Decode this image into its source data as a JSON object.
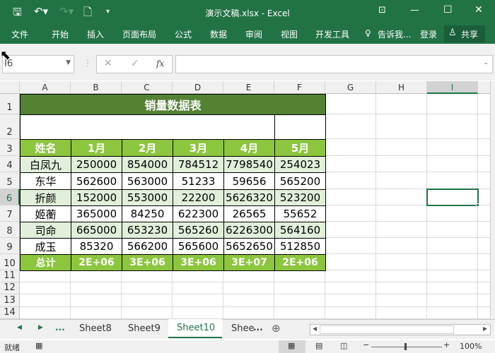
{
  "window": {
    "title": "演示文稿.xlsx - Excel"
  },
  "ribbon": {
    "tabs": [
      "文件",
      "开始",
      "插入",
      "页面布局",
      "公式",
      "数据",
      "审阅",
      "视图",
      "开发工具"
    ],
    "tell_me": "告诉我...",
    "login": "登录",
    "share": "共享"
  },
  "formula_bar": {
    "name_box": "I6",
    "fx": "fx",
    "value": ""
  },
  "columns": [
    "A",
    "B",
    "C",
    "D",
    "E",
    "F",
    "G",
    "H",
    "I"
  ],
  "rows": [
    "1",
    "2",
    "3",
    "4",
    "5",
    "6",
    "7",
    "8",
    "9",
    "10",
    "11",
    "12",
    "13",
    "14"
  ],
  "table": {
    "title": "销量数据表",
    "headers": [
      "姓名",
      "1月",
      "2月",
      "3月",
      "4月",
      "5月"
    ],
    "data": [
      [
        "白凤九",
        "250000",
        "854000",
        "784512",
        "7798540",
        "254023"
      ],
      [
        "东华",
        "562600",
        "563000",
        "51233",
        "59656",
        "565200"
      ],
      [
        "折颜",
        "152000",
        "553000",
        "22200",
        "5626320",
        "523200"
      ],
      [
        "姬蘅",
        "365000",
        "84250",
        "622300",
        "26565",
        "55652"
      ],
      [
        "司命",
        "665000",
        "653230",
        "565260",
        "6226300",
        "564160"
      ],
      [
        "成玉",
        "85320",
        "566200",
        "565600",
        "5652650",
        "512850"
      ]
    ],
    "total": [
      "总计",
      "2E+06",
      "3E+06",
      "3E+06",
      "3E+07",
      "2E+06"
    ]
  },
  "sheet_tabs": {
    "items": [
      "Sheet8",
      "Sheet9",
      "Sheet10",
      "Shee"
    ],
    "active": "Sheet10",
    "ellipsis": "..."
  },
  "status": {
    "ready": "就绪",
    "zoom": "100%"
  },
  "colors": {
    "excel_green": "#217346",
    "title_fill": "#548235",
    "header_fill": "#8cc63f",
    "stripe_fill": "#e2efda"
  }
}
